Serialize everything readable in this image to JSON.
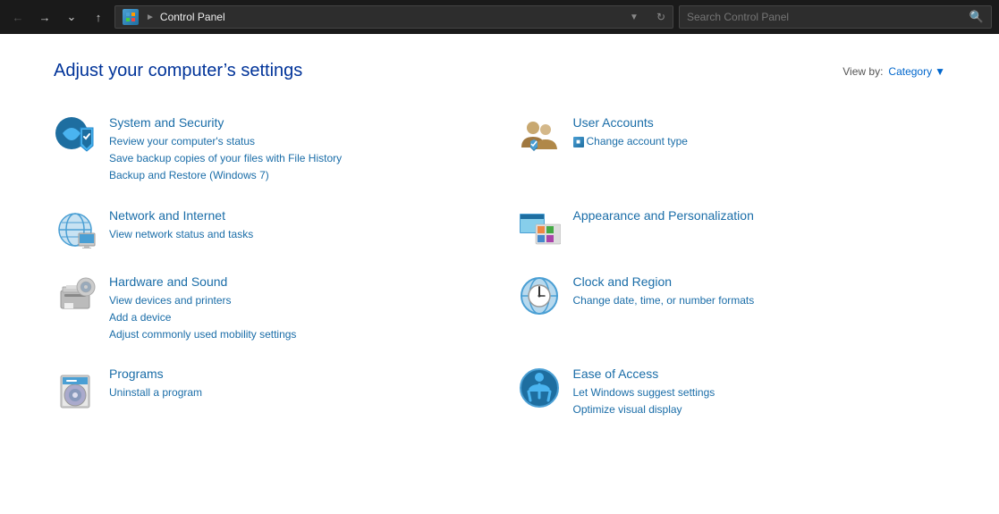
{
  "titlebar": {
    "address": "Control Panel",
    "search_placeholder": "Search Control Panel"
  },
  "page": {
    "title": "Adjust your computer’s settings",
    "view_by_label": "View by:",
    "view_by_value": "Category"
  },
  "panels": [
    {
      "id": "system-security",
      "title": "System and Security",
      "links": [
        "Review your computer’s status",
        "Save backup copies of your files with File History",
        "Backup and Restore (Windows 7)"
      ]
    },
    {
      "id": "user-accounts",
      "title": "User Accounts",
      "links": [
        "Change account type"
      ]
    },
    {
      "id": "network-internet",
      "title": "Network and Internet",
      "links": [
        "View network status and tasks"
      ]
    },
    {
      "id": "appearance",
      "title": "Appearance and Personalization",
      "links": []
    },
    {
      "id": "hardware-sound",
      "title": "Hardware and Sound",
      "links": [
        "View devices and printers",
        "Add a device",
        "Adjust commonly used mobility settings"
      ]
    },
    {
      "id": "clock-region",
      "title": "Clock and Region",
      "links": [
        "Change date, time, or number formats"
      ]
    },
    {
      "id": "programs",
      "title": "Programs",
      "links": [
        "Uninstall a program"
      ]
    },
    {
      "id": "ease-of-access",
      "title": "Ease of Access",
      "links": [
        "Let Windows suggest settings",
        "Optimize visual display"
      ]
    }
  ]
}
